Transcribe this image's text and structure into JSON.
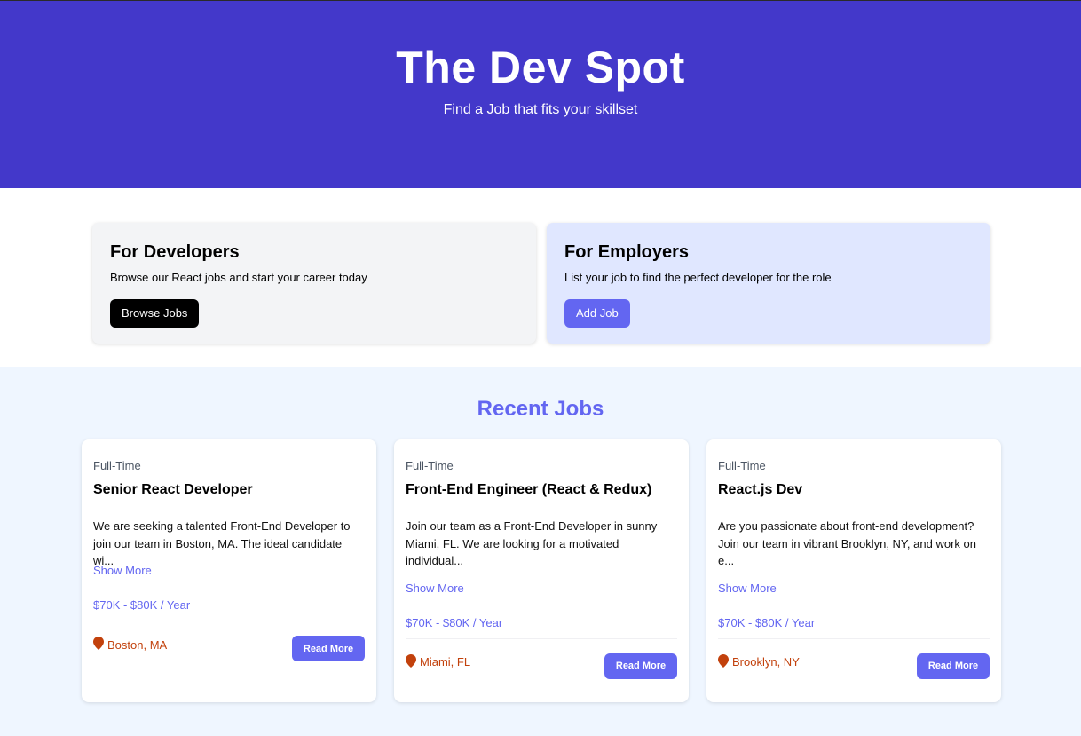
{
  "hero": {
    "title": "The Dev Spot",
    "subtitle": "Find a Job that fits your skillset"
  },
  "promos": {
    "developers": {
      "title": "For Developers",
      "description": "Browse our React jobs and start your career today",
      "button": "Browse Jobs"
    },
    "employers": {
      "title": "For Employers",
      "description": "List your job to find the perfect developer for the role",
      "button": "Add Job"
    }
  },
  "recent_jobs": {
    "heading": "Recent Jobs",
    "jobs": [
      {
        "type": "Full-Time",
        "title": "Senior React Developer",
        "description_lines": [
          "We are seeking a talented Front-End Developer to",
          "join our team in Boston, MA. The ideal candidate wi..."
        ],
        "show_more": "Show More",
        "salary": "$70K - $80K / Year",
        "location": "Boston, MA",
        "button": "Read More"
      },
      {
        "type": "Full-Time",
        "title": "Front-End Engineer (React & Redux)",
        "description_lines": [
          "Join our team as a Front-End Developer in sunny",
          "Miami, FL. We are looking for a motivated",
          "individual..."
        ],
        "show_more": "Show More",
        "salary": "$70K - $80K / Year",
        "location": "Miami, FL",
        "button": "Read More"
      },
      {
        "type": "Full-Time",
        "title": "React.js Dev",
        "description_lines": [
          "Are you passionate about front-end development?",
          "Join our team in vibrant Brooklyn, NY, and work on",
          "e..."
        ],
        "show_more": "Show More",
        "salary": "$70K - $80K / Year",
        "location": "Brooklyn, NY",
        "button": "Read More"
      }
    ]
  },
  "colors": {
    "hero_bg": "#4338ca",
    "accent": "#6366f1",
    "location": "#c2410c",
    "jobs_bg": "#eff6ff",
    "employer_card_bg": "#e0e7ff"
  },
  "icons": {
    "location": "map-marker-icon"
  }
}
